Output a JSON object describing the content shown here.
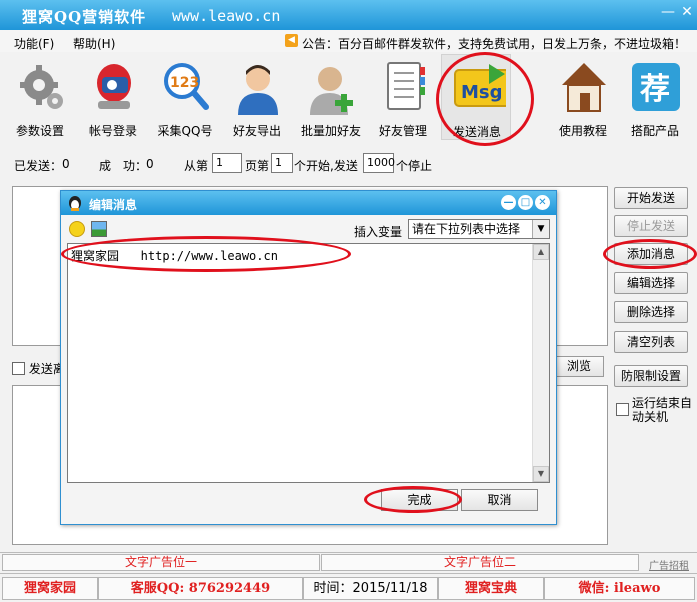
{
  "window": {
    "title": "狸窝QQ营销软件",
    "url": "www.leawo.cn",
    "minimize": "—",
    "close": "✕"
  },
  "menu": {
    "items": [
      "功能(F)",
      "帮助(H)"
    ],
    "announcement": "公告：百分百邮件群发软件，支持免费试用，日发上万条，不进垃圾箱！"
  },
  "toolbar": {
    "items": [
      {
        "label": "参数设置",
        "icon": "gear-icon"
      },
      {
        "label": "帐号登录",
        "icon": "qq-login-icon"
      },
      {
        "label": "采集QQ号",
        "icon": "magnifier-123-icon"
      },
      {
        "label": "好友导出",
        "icon": "user-icon"
      },
      {
        "label": "批量加好友",
        "icon": "add-user-icon"
      },
      {
        "label": "好友管理",
        "icon": "address-book-icon"
      },
      {
        "label": "发送消息",
        "icon": "msg-icon",
        "icon_text": "Msg"
      },
      {
        "label": "使用教程",
        "icon": "house-icon"
      },
      {
        "label": "搭配产品",
        "icon": "recommend-icon",
        "icon_text": "荐"
      }
    ]
  },
  "stats": {
    "sent_label": "已发送：",
    "sent_value": "0",
    "success_label": "成　功：",
    "success_value": "0",
    "from_page_label": "从第",
    "from_page_value": "1",
    "page_suffix": "页第",
    "start_item_value": "1",
    "start_send_label": "个开始,发送",
    "send_count_value": "1000",
    "stop_label": "个停止"
  },
  "main": {
    "checkbox_label": "发送离",
    "browse_button": "浏览"
  },
  "right_buttons": [
    "开始发送",
    "停止发送",
    "添加消息",
    "编辑选择",
    "删除选择",
    "清空列表",
    "防限制设置"
  ],
  "shutdown_label": "运行结束自动关机",
  "ads": {
    "left": "文字广告位一",
    "right": "文字广告位二",
    "manage": "广告招租"
  },
  "statusbar": {
    "brand": "狸窝家园",
    "service": "客服QQ: 876292449",
    "time_label": "时间：",
    "time_value": "2015/11/18",
    "treasure": "狸窝宝典",
    "wechat": "微信: ileawo"
  },
  "dialog": {
    "title": "编辑消息",
    "insert_label": "插入变量",
    "insert_select": "请在下拉列表中选择",
    "message_text": "狸窝家园   http://www.leawo.cn",
    "ok_button": "完成",
    "cancel_button": "取消",
    "min": "—",
    "max": "□",
    "close": "✕"
  },
  "colors": {
    "titlebar": "#1f95d8",
    "annotation": "#e0101c",
    "ad_text": "#e02020"
  }
}
